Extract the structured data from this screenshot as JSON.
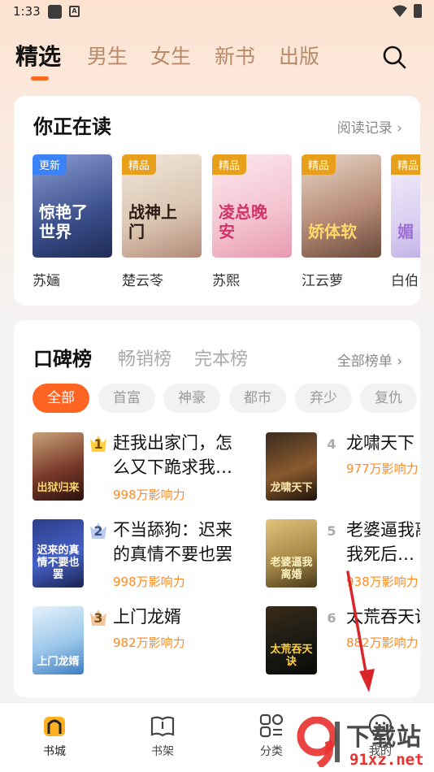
{
  "status": {
    "time": "1:33",
    "app_icon": "A"
  },
  "top_tabs": [
    "精选",
    "男生",
    "女生",
    "新书",
    "出版"
  ],
  "reading": {
    "title": "你正在读",
    "link": "阅读记录",
    "books": [
      {
        "name": "苏婳",
        "badge": "更新",
        "cover": "惊艳了世界"
      },
      {
        "name": "楚云苓",
        "badge": "精品",
        "cover": "战神上门"
      },
      {
        "name": "苏熙",
        "badge": "精品",
        "cover": "凌总晚安"
      },
      {
        "name": "江云萝",
        "badge": "精品",
        "cover": "娇体软"
      },
      {
        "name": "白伯",
        "badge": "精品",
        "cover": "媚"
      }
    ]
  },
  "ranking": {
    "tabs": [
      "口碑榜",
      "畅销榜",
      "完本榜"
    ],
    "link": "全部榜单",
    "chips": [
      "全部",
      "首富",
      "神豪",
      "都市",
      "弃少",
      "复仇"
    ],
    "items": [
      {
        "rank": "1",
        "title": "赶我出家门，怎么又下跪求我…",
        "meta": "998万影响力",
        "cover": "出狱归来"
      },
      {
        "rank": "2",
        "title": "不当舔狗：迟来的真情不要也罢",
        "meta": "998万影响力",
        "cover": "迟来的真情不要也罢"
      },
      {
        "rank": "3",
        "title": "上门龙婿",
        "meta": "982万影响力",
        "cover": "上门龙婿"
      },
      {
        "rank": "4",
        "title": "龙啸天下",
        "meta": "977万影响力",
        "cover": "龙啸天下"
      },
      {
        "rank": "5",
        "title": "老婆逼我离婚，我死后…",
        "meta": "938万影响力",
        "cover": "老婆逼我离婚"
      },
      {
        "rank": "6",
        "title": "太荒吞天诀",
        "meta": "882万影响力",
        "cover": "太荒吞天诀"
      }
    ]
  },
  "bottom_nav": [
    "书城",
    "书架",
    "分类",
    "我的"
  ],
  "watermark": {
    "line1": "下载站",
    "line2": "91xz.net"
  },
  "colors": {
    "accent": "#ff6423",
    "meta": "#ff8a1f"
  }
}
